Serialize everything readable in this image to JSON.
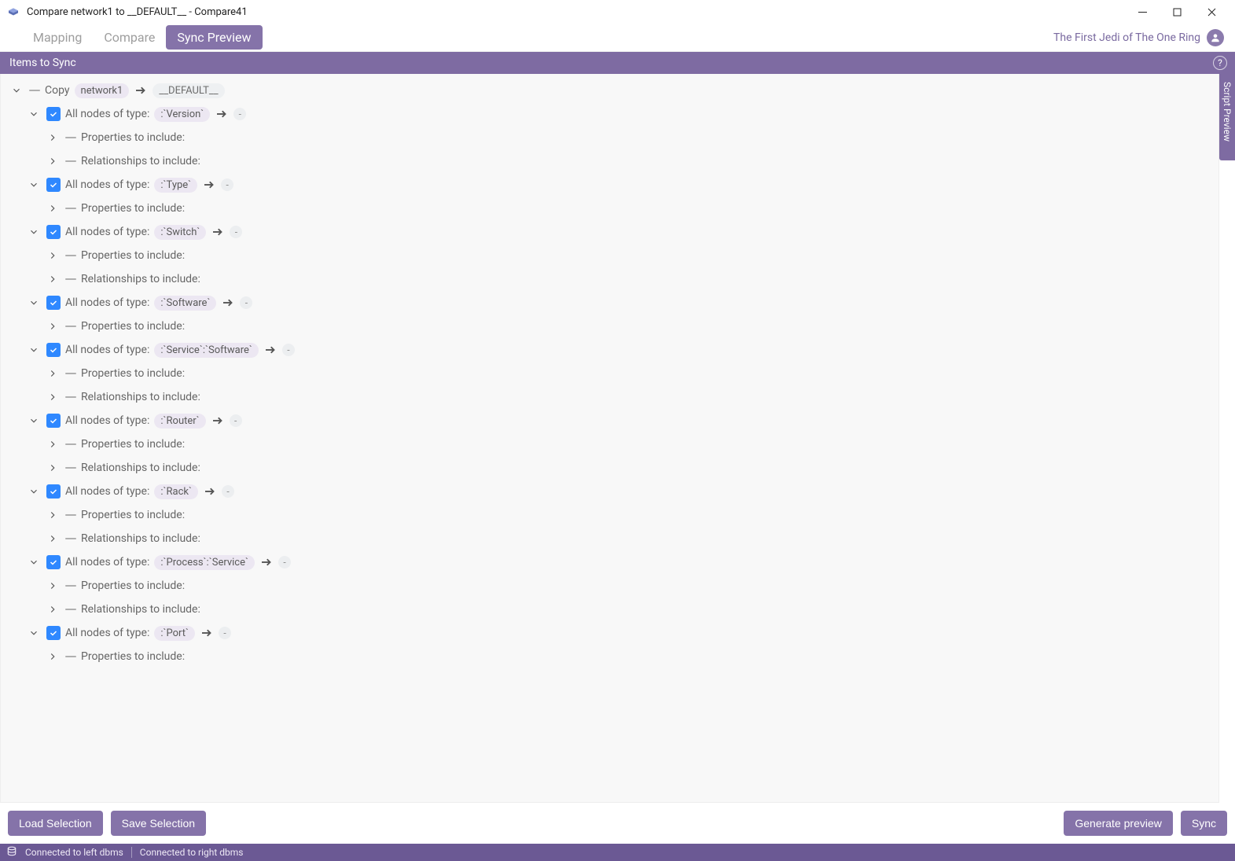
{
  "window": {
    "title": "Compare network1 to __DEFAULT__ - Compare41"
  },
  "tabs": [
    {
      "label": "Mapping",
      "active": false
    },
    {
      "label": "Compare",
      "active": false
    },
    {
      "label": "Sync Preview",
      "active": true
    }
  ],
  "user": {
    "name": "The First Jedi of The One Ring"
  },
  "section": {
    "title": "Items to Sync",
    "help": "?"
  },
  "side_tab": {
    "label": "Script Preview"
  },
  "copy_row": {
    "label": "Copy",
    "source": "network1",
    "target": "__DEFAULT__"
  },
  "labels": {
    "all_nodes": "All nodes of type:",
    "props": "Properties to include:",
    "rels": "Relationships to include:"
  },
  "node_types": [
    {
      "tag": ":`Version`",
      "children": [
        "props",
        "rels"
      ]
    },
    {
      "tag": ":`Type`",
      "children": [
        "props"
      ]
    },
    {
      "tag": ":`Switch`",
      "children": [
        "props",
        "rels"
      ]
    },
    {
      "tag": ":`Software`",
      "children": [
        "props"
      ]
    },
    {
      "tag": ":`Service`:`Software`",
      "children": [
        "props",
        "rels"
      ]
    },
    {
      "tag": ":`Router`",
      "children": [
        "props",
        "rels"
      ]
    },
    {
      "tag": ":`Rack`",
      "children": [
        "props",
        "rels"
      ]
    },
    {
      "tag": ":`Process`:`Service`",
      "children": [
        "props",
        "rels"
      ]
    },
    {
      "tag": ":`Port`",
      "children": [
        "props"
      ]
    }
  ],
  "buttons": {
    "load": "Load Selection",
    "save": "Save Selection",
    "generate": "Generate preview",
    "sync": "Sync"
  },
  "status": {
    "left": "Connected to left dbms",
    "right": "Connected to right dbms"
  }
}
